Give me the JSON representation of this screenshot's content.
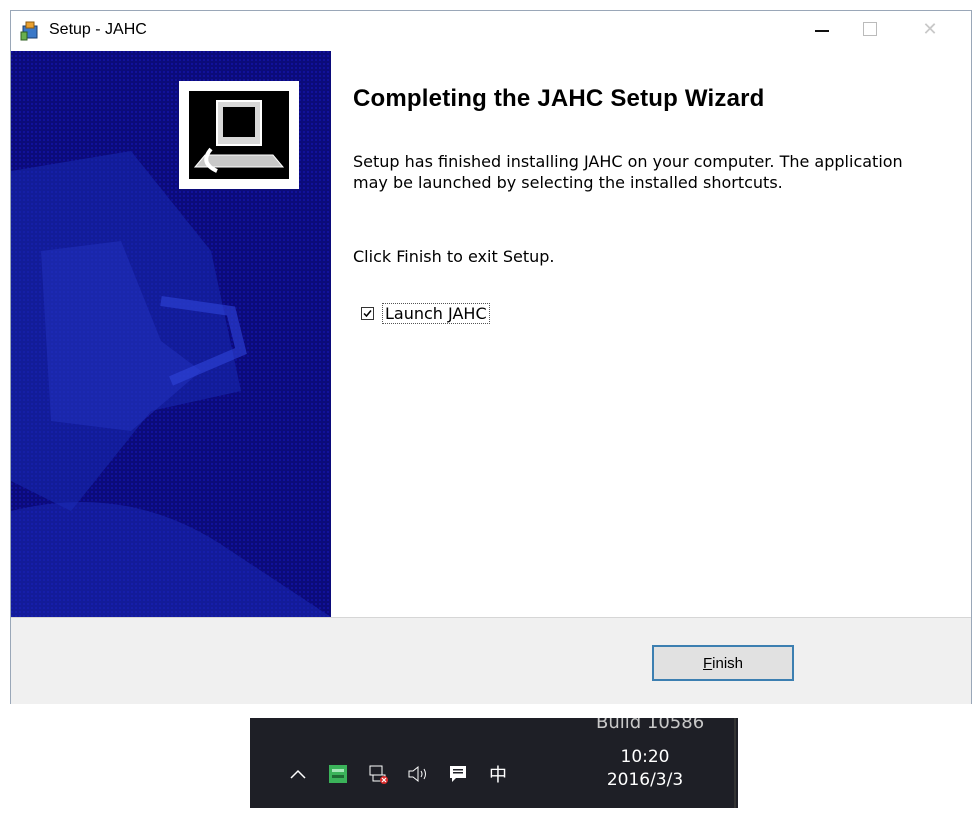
{
  "window": {
    "title": "Setup - JAHC",
    "minimize_label": "—",
    "close_label": "✕"
  },
  "content": {
    "heading": "Completing the JAHC Setup Wizard",
    "description": "Setup has finished installing JAHC on your computer. The application may be launched by selecting the installed shortcuts.",
    "click_finish": "Click Finish to exit Setup.",
    "launch_checkbox": {
      "label": "Launch JAHC",
      "checked": true
    }
  },
  "footer": {
    "finish_label_prefix": "F",
    "finish_label_rest": "inish"
  },
  "taskbar": {
    "build": "Build 10586",
    "tray_icons": [
      "chevron-up-icon",
      "app-tray-icon",
      "network-disconnected-icon",
      "volume-icon",
      "notification-icon",
      "ime-chinese-icon"
    ],
    "ime_text": "中",
    "volume_text": "🔈)",
    "chevron_text": "︿",
    "time": "10:20",
    "date": "2016/3/3"
  },
  "colors": {
    "banner": "#0b0b7a",
    "button_border": "#3c7fb1",
    "taskbar": "#1e1f26"
  }
}
